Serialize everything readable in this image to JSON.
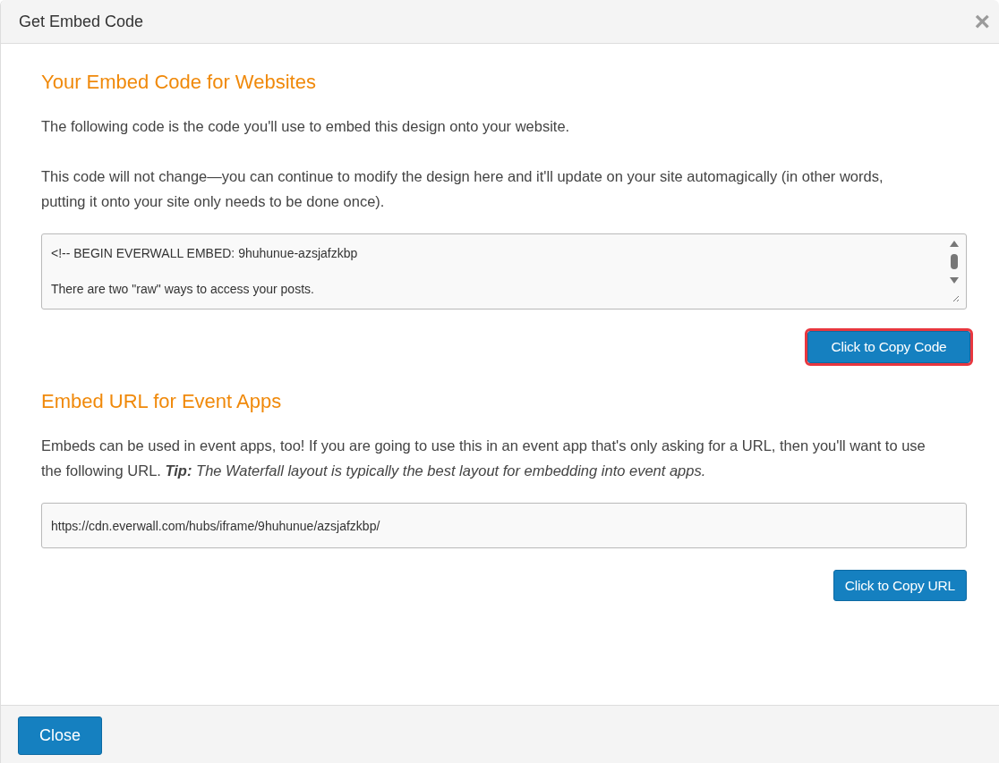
{
  "window": {
    "title": "Get Embed Code",
    "close_icon": "×"
  },
  "sections": [
    {
      "heading": "Your Embed Code for Websites",
      "paragraphs": [
        "The following code is the code you'll use to embed this design onto your website.",
        "This code will not change—you can continue to modify the design here and it'll update on your site automagically (in other words, putting it onto your site only needs to be done once)."
      ],
      "field": {
        "kind": "textarea",
        "value": "<!-- BEGIN EVERWALL EMBED: 9huhunue-azsjafzkbp\n\nThere are two \"raw\" ways to access your posts."
      },
      "button": {
        "label": "Click to Copy Code",
        "highlighted": true
      }
    },
    {
      "heading": "Embed URL for Event Apps",
      "paragraphs": [
        "Embeds can be used in event apps, too! If you are going to use this in an event app that's only asking for a URL, then you'll want to use the following URL. **Tip:** *The Waterfall layout is typically the best layout for embedding into event apps.*"
      ],
      "field": {
        "kind": "input",
        "value": "https://cdn.everwall.com/hubs/iframe/9huhunue/azsjafzkbp/"
      },
      "button": {
        "label": "Click to Copy URL",
        "highlighted": false
      }
    }
  ],
  "footer": {
    "button": "Close"
  }
}
